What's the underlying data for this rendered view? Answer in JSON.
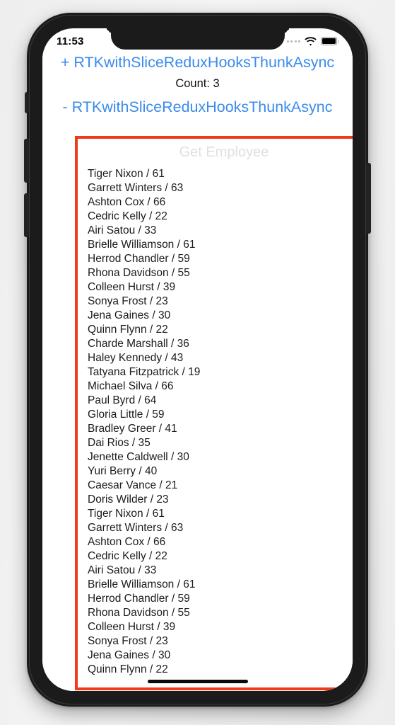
{
  "status_bar": {
    "time": "11:53",
    "signal_icon": "signal-dots-icon",
    "wifi_icon": "wifi-icon",
    "battery_icon": "battery-full-icon"
  },
  "app": {
    "increment_link": "+ RTKwithSliceReduxHooksThunkAsync",
    "count_label": "Count: 3",
    "decrement_link": "- RTKwithSliceReduxHooksThunkAsync",
    "section_title": "Get Employee",
    "employees": [
      "Tiger Nixon / 61",
      "Garrett Winters / 63",
      "Ashton Cox / 66",
      "Cedric Kelly / 22",
      "Airi Satou / 33",
      "Brielle Williamson / 61",
      "Herrod Chandler / 59",
      "Rhona Davidson / 55",
      "Colleen Hurst / 39",
      "Sonya Frost / 23",
      "Jena Gaines / 30",
      "Quinn Flynn / 22",
      "Charde Marshall / 36",
      "Haley Kennedy / 43",
      "Tatyana Fitzpatrick / 19",
      "Michael Silva / 66",
      "Paul Byrd / 64",
      "Gloria Little / 59",
      "Bradley Greer / 41",
      "Dai Rios / 35",
      "Jenette Caldwell / 30",
      "Yuri Berry / 40",
      "Caesar Vance / 21",
      "Doris Wilder / 23",
      "Tiger Nixon / 61",
      "Garrett Winters / 63",
      "Ashton Cox / 66",
      "Cedric Kelly / 22",
      "Airi Satou / 33",
      "Brielle Williamson / 61",
      "Herrod Chandler / 59",
      "Rhona Davidson / 55",
      "Colleen Hurst / 39",
      "Sonya Frost / 23",
      "Jena Gaines / 30",
      "Quinn Flynn / 22"
    ]
  },
  "colors": {
    "link_blue": "#3b8beb",
    "highlight_red": "#ee3b1b",
    "section_title_gray": "#e0e0e0",
    "frame_black": "#1b1b1b",
    "page_background": "#f1f1f1"
  }
}
